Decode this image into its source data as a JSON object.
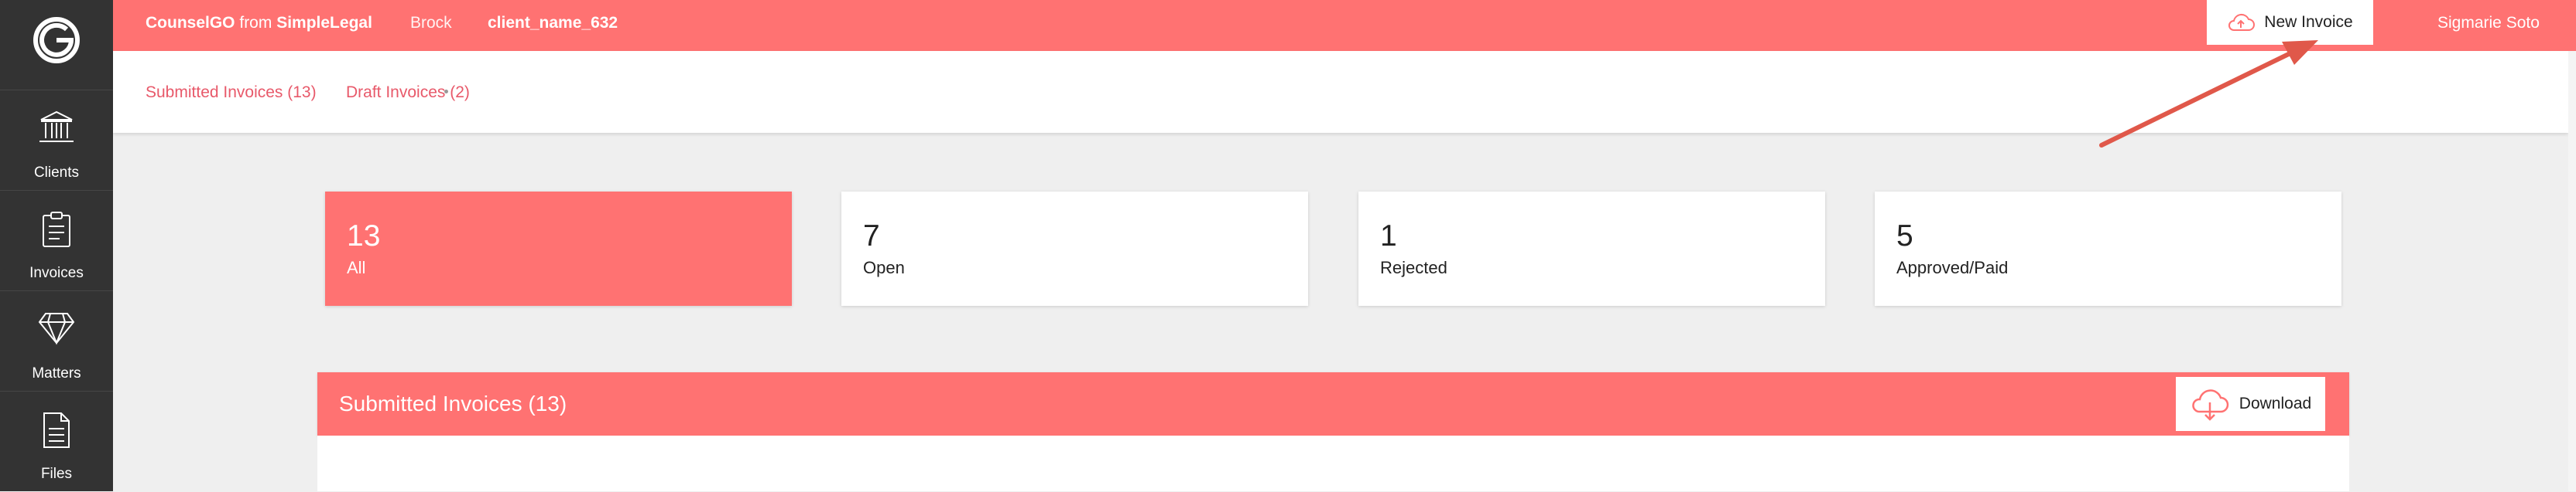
{
  "sidebar": {
    "logo_icon": "counselgo-logo-icon",
    "items": [
      {
        "label": "Clients",
        "icon": "bank-icon"
      },
      {
        "label": "Invoices",
        "icon": "clipboard-icon"
      },
      {
        "label": "Matters",
        "icon": "diamond-icon"
      },
      {
        "label": "Files",
        "icon": "file-icon"
      }
    ]
  },
  "header": {
    "brand": "CounselGO",
    "brand_from": "from",
    "brand_company": "SimpleLegal",
    "firm": "Brock",
    "client": "client_name_632",
    "new_invoice_label": "New Invoice",
    "user_name": "Sigmarie Soto Alfonzo"
  },
  "tabs": [
    {
      "label": "Submitted Invoices (13)"
    },
    {
      "label": "Draft Invoices (2)"
    }
  ],
  "stats": [
    {
      "count": "13",
      "label": "All"
    },
    {
      "count": "7",
      "label": "Open"
    },
    {
      "count": "1",
      "label": "Rejected"
    },
    {
      "count": "5",
      "label": "Approved/Paid"
    }
  ],
  "panel": {
    "title": "Submitted Invoices (13)",
    "download_label": "Download"
  },
  "colors": {
    "accent": "#ff7272",
    "sidebar": "#333333",
    "link": "#e8596a",
    "annotation_arrow": "#e0584a"
  }
}
